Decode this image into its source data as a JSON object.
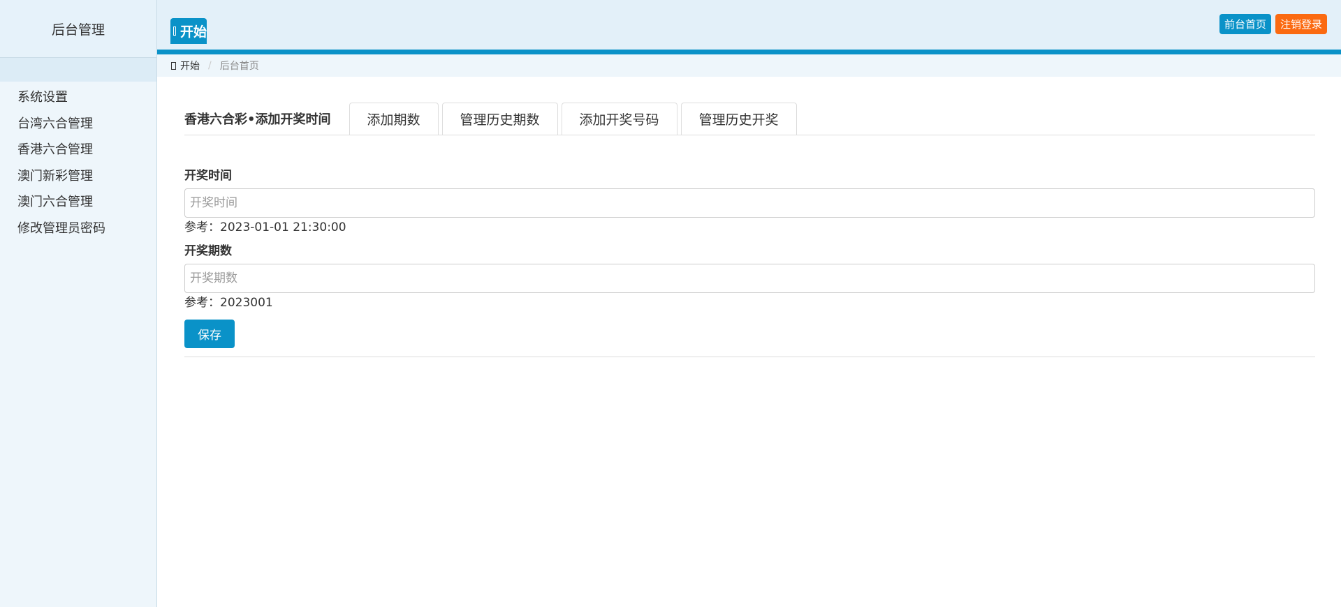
{
  "sidebar": {
    "title": "后台管理",
    "items": [
      {
        "label": "系统设置"
      },
      {
        "label": "台湾六合管理"
      },
      {
        "label": "香港六合管理"
      },
      {
        "label": "澳门新彩管理"
      },
      {
        "label": "澳门六合管理"
      },
      {
        "label": "修改管理员密码"
      }
    ]
  },
  "topbar": {
    "tab_label": "开始",
    "front_label": "前台首页",
    "logout_label": "注销登录"
  },
  "breadcrumb": {
    "home": "开始",
    "current": "后台首页"
  },
  "main": {
    "section_title": "香港六合彩•添加开奖时间",
    "tabs": [
      {
        "label": "添加期数"
      },
      {
        "label": "管理历史期数"
      },
      {
        "label": "添加开奖号码"
      },
      {
        "label": "管理历史开奖"
      }
    ],
    "form": {
      "time_label": "开奖时间",
      "time_placeholder": "开奖时间",
      "time_value": "",
      "time_hint": "参考：2023-01-01 21:30:00",
      "period_label": "开奖期数",
      "period_placeholder": "开奖期数",
      "period_value": "",
      "period_hint": "参考：2023001",
      "save_label": "保存"
    }
  },
  "colors": {
    "primary": "#0a92c8",
    "logout": "#fb6a11",
    "sidebar_bg": "#eef6fb"
  }
}
